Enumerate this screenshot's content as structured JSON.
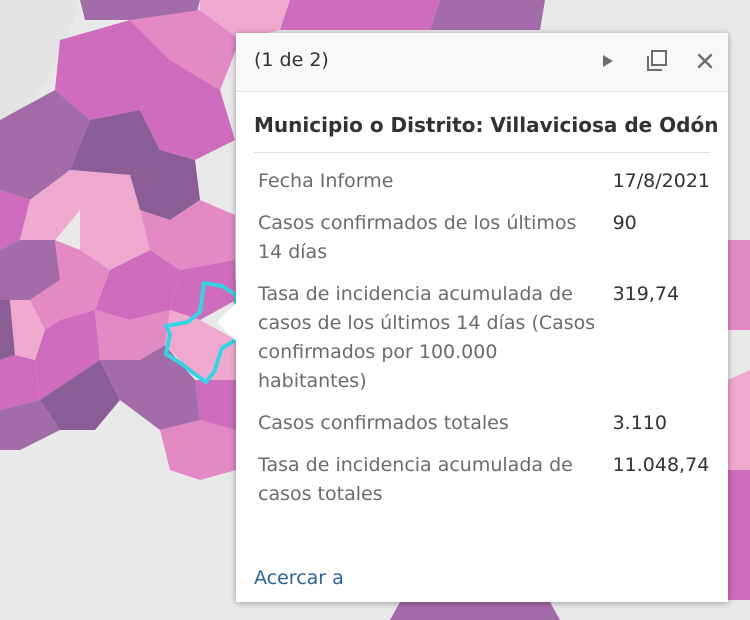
{
  "map": {
    "colors": {
      "light_pink": "#efa9cf",
      "pink": "#e389c3",
      "magenta": "#cf6cbd",
      "purple": "#a46ba9",
      "dark_purple": "#8a5d94",
      "mauve": "#9b6e96",
      "background": "#e9e9e9",
      "highlight": "#36d3e3"
    }
  },
  "popup": {
    "counter": "(1 de 2)",
    "title": "Municipio o Distrito: Villaviciosa de Odón",
    "fields": [
      {
        "name": "Fecha Informe",
        "value": "17/8/2021"
      },
      {
        "name": "Casos confirmados de los últimos 14 días",
        "value": "90"
      },
      {
        "name": "Tasa de incidencia acumulada de casos de los últimos 14 días (Casos confirmados por 100.000 habitantes)",
        "value": "319,74"
      },
      {
        "name": "Casos confirmados totales",
        "value": "3.110"
      },
      {
        "name": "Tasa de incidencia acumulada de casos totales",
        "value": "11.048,74"
      }
    ],
    "zoom_link": "Acercar a",
    "icons": {
      "next": "play-icon",
      "dock": "dock-window-icon",
      "close": "close-icon"
    }
  }
}
